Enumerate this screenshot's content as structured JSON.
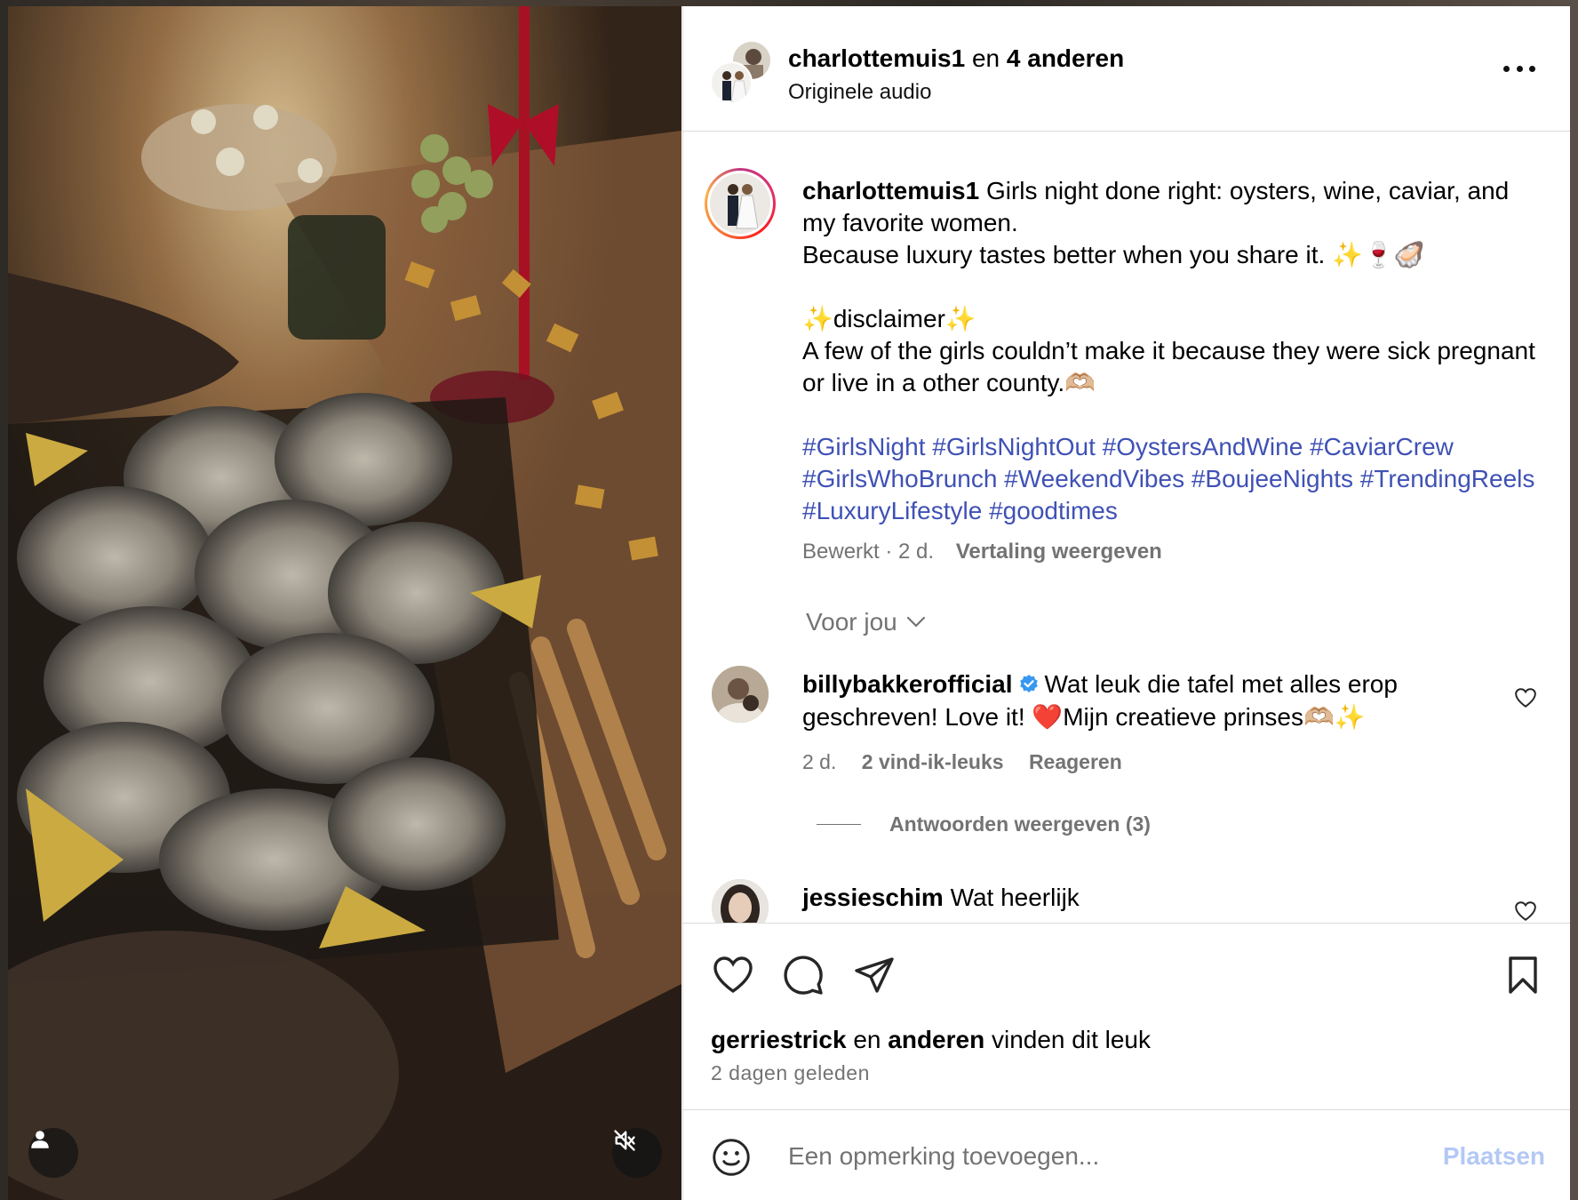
{
  "header": {
    "author": "charlottemuis1",
    "joiner": "en",
    "coauthors": "4 anderen",
    "audio": "Originele audio"
  },
  "caption": {
    "username": "charlottemuis1",
    "line1": "Girls night done right: oysters, wine, caviar, and my favorite women.",
    "line2": "Because luxury tastes better when you share it. ✨🍷🦪",
    "line3": "✨disclaimer✨",
    "line4": "A few of the girls couldn’t make it because they were sick pregnant or live in a other county.🫶🏼",
    "hashtags": "#GirlsNight #GirlsNightOut #OystersAndWine #CaviarCrew #GirlsWhoBrunch #WeekendVibes #BoujeeNights #TrendingReels #LuxuryLifestyle #goodtimes",
    "edited": "Bewerkt · 2 d.",
    "translate": "Vertaling weergeven"
  },
  "filter": {
    "label": "Voor jou"
  },
  "comments": [
    {
      "username": "billybakkerofficial",
      "text": "Wat leuk die tafel met alles erop geschreven! Love it! ❤️Mijn creatieve prinses🫶🏼✨",
      "age": "2 d.",
      "likes": "2 vind-ik-leuks",
      "reply": "Reageren",
      "view_replies": "Antwoorden weergeven (3)"
    },
    {
      "username": "jessieschim",
      "text": "Wat heerlijk"
    }
  ],
  "likes": {
    "user": "gerriestrick",
    "joiner": "en",
    "others": "anderen",
    "suffix": "vinden dit leuk"
  },
  "date": "2 dagen geleden",
  "add_comment": {
    "placeholder": "Een opmerking toevoegen...",
    "post_label": "Plaatsen"
  },
  "colors": {
    "hashtag": "#3f51b5",
    "post_button_disabled": "#b3c8f5",
    "verified": "#3897f0",
    "secondary_text": "#737373"
  }
}
